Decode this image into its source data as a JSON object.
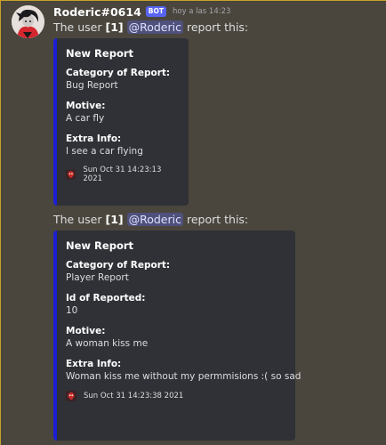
{
  "message": {
    "username": "Roderic#0614",
    "bot_tag": "BOT",
    "timestamp": "hoy a las 14:23"
  },
  "reports": [
    {
      "intro_prefix": "The user",
      "intro_index": "[1]",
      "mention": "@Roderic",
      "intro_suffix": "report this:",
      "embed": {
        "title": "New Report",
        "fields": [
          {
            "name": "Category of Report:",
            "value": "Bug Report"
          },
          {
            "name": "Motive:",
            "value": "A car fly"
          },
          {
            "name": "Extra Info:",
            "value": "I see a car flying"
          }
        ],
        "footer": "Sun Oct 31 14:23:13 2021"
      }
    },
    {
      "intro_prefix": "The user",
      "intro_index": "[1]",
      "mention": "@Roderic",
      "intro_suffix": "report this:",
      "embed": {
        "title": "New Report",
        "fields": [
          {
            "name": "Category of Report:",
            "value": "Player Report"
          },
          {
            "name": "Id of Reported:",
            "value": "10"
          },
          {
            "name": "Motive:",
            "value": "A woman kiss me"
          },
          {
            "name": "Extra Info:",
            "value": "Woman kiss me without my permmisions :( so sad"
          }
        ],
        "footer": "Sun Oct 31 14:23:38 2021"
      }
    }
  ],
  "colors": {
    "background": "#4a463e",
    "embed_background": "#2f3136",
    "embed_accent": "#1c1fd2",
    "bot_tag": "#5865f2"
  },
  "icons": {
    "avatar": "character-avatar",
    "footer": "skull-icon"
  }
}
